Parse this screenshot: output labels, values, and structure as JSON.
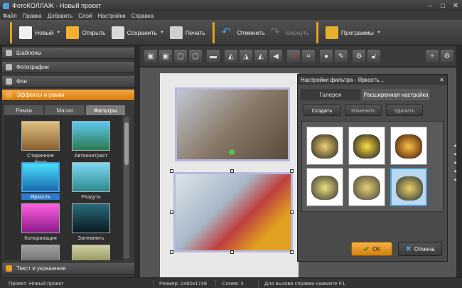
{
  "window": {
    "title": "ФотоКОЛЛАЖ - Новый проект"
  },
  "menu": [
    "Файл",
    "Правка",
    "Добавить",
    "Слой",
    "Настройки",
    "Справка"
  ],
  "toolbar": {
    "new": "Новый",
    "open": "Открыть",
    "save": "Сохранить",
    "print": "Печать",
    "undo": "Отменить",
    "redo": "Вернуть",
    "programs": "Программы"
  },
  "left_panel": {
    "sections": {
      "templates": "Шаблоны",
      "photos": "Фотографии",
      "background": "Фон",
      "effects": "Эффекты и рамки",
      "text": "Текст и украшения"
    },
    "tabs": [
      "Рамки",
      "Маски",
      "Фильтры"
    ],
    "thumbs": [
      {
        "label": "Старинное фото",
        "color": "#c8a060"
      },
      {
        "label": "Автоконтраст",
        "color": "#3a9ad0"
      },
      {
        "label": "Яркость",
        "color": "#2cc8ff"
      },
      {
        "label": "Раздуть",
        "color": "#4ab8c8"
      },
      {
        "label": "Колоризация",
        "color": "#e040c0"
      },
      {
        "label": "Затемнить",
        "color": "#1a4a5a"
      }
    ]
  },
  "dialog": {
    "title": "Настройки фильтра - Яркость...",
    "tabs": [
      "Галерея",
      "Расширенная настройка"
    ],
    "buttons": {
      "create": "Создать",
      "edit": "Изменить",
      "delete": "Удалить"
    },
    "ok": "ОК",
    "cancel": "Отмена"
  },
  "status": {
    "project": "Проект: Новый проект",
    "size": "Размер:  2480x1748",
    "layers": "Слоев:  3",
    "help": "Для вызова справки нажмите F1."
  },
  "colors": {
    "accent": "#e4a020",
    "selection": "#4a9fd8"
  }
}
